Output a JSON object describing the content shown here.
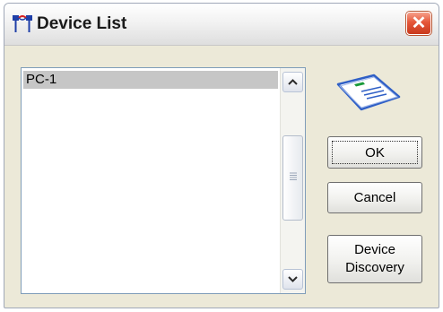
{
  "window": {
    "title": "Device List",
    "close_glyph": "✕"
  },
  "device_list": {
    "items": [
      "PC-1"
    ],
    "selected_index": 0
  },
  "scrollbar": {
    "up_icon": "chevron-up-icon",
    "down_icon": "chevron-down-icon"
  },
  "buttons": {
    "ok": "OK",
    "cancel": "Cancel",
    "discovery_line1": "Device",
    "discovery_line2": "Discovery"
  },
  "icons": {
    "app_icon": "network-link-icon",
    "card_icon": "network-card-icon"
  },
  "colors": {
    "window_bg": "#ece9d8",
    "selection": "#c6c6c6",
    "close_red": "#e5573a",
    "card_blue": "#2f5fc6"
  }
}
